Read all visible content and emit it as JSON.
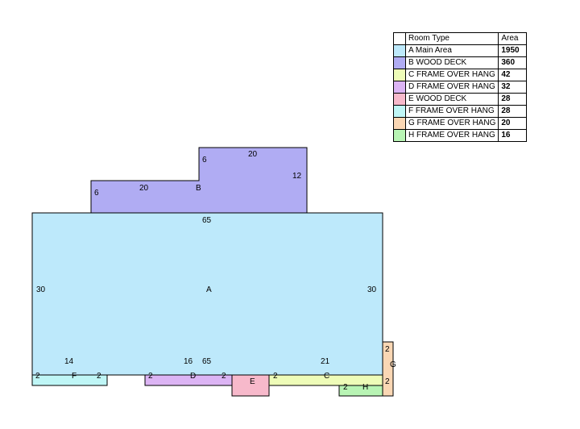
{
  "legend": {
    "header_type": "Room Type",
    "header_area": "Area",
    "rows": [
      {
        "name": "A Main Area",
        "area": "1950",
        "color": "#bde9fb"
      },
      {
        "name": "B WOOD DECK",
        "area": "360",
        "color": "#b0acf3"
      },
      {
        "name": "C FRAME OVER HANG",
        "area": "42",
        "color": "#eefcb8"
      },
      {
        "name": "D FRAME OVER HANG",
        "area": "32",
        "color": "#dcb4f4"
      },
      {
        "name": "E WOOD DECK",
        "area": "28",
        "color": "#f7b9cb"
      },
      {
        "name": "F FRAME OVER HANG",
        "area": "28",
        "color": "#bff6f6"
      },
      {
        "name": "G FRAME OVER HANG",
        "area": "20",
        "color": "#fad7b4"
      },
      {
        "name": "H FRAME OVER HANG",
        "area": "16",
        "color": "#b8f4b4"
      }
    ]
  },
  "plan": {
    "main": {
      "letter": "A",
      "top": "65",
      "left": "30",
      "right": "30",
      "bottom_left": "16",
      "bottom_right": "65"
    },
    "deck": {
      "letter": "B",
      "left_h": "6",
      "top_w": "20",
      "step_h": "6",
      "upper_w": "20",
      "upper_h": "12"
    },
    "f": {
      "letter": "F",
      "w": "14",
      "left": "2",
      "right": "2"
    },
    "d": {
      "letter": "D",
      "left": "2",
      "right": "2"
    },
    "e": {
      "letter": "E"
    },
    "c": {
      "letter": "C",
      "w": "21",
      "left": "2"
    },
    "h": {
      "letter": "H",
      "left": "2"
    },
    "g": {
      "letter": "G",
      "top": "2",
      "bottom": "2"
    }
  }
}
